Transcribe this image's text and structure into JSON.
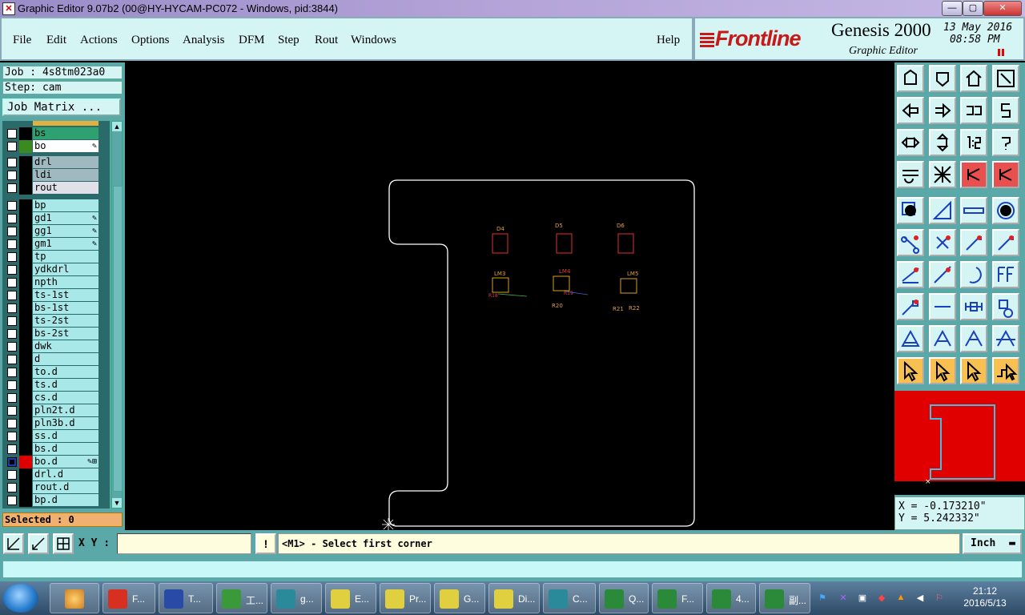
{
  "window": {
    "title": "Graphic Editor 9.07b2 (00@HY-HYCAM-PC072 - Windows, pid:3844)",
    "controls": {
      "minimize": "—",
      "restore": "▢",
      "close": "✕"
    }
  },
  "menu": [
    "File",
    "Edit",
    "Actions",
    "Options",
    "Analysis",
    "DFM",
    "Step",
    "Rout",
    "Windows"
  ],
  "menu_help": "Help",
  "brand": {
    "logo": "Frontline",
    "product": "Genesis 2000",
    "subtitle": "Graphic Editor",
    "date": "13 May 2016",
    "time": "08:58 PM"
  },
  "job": {
    "job_label": "Job : 4s8tm023a0",
    "step_label": "Step: cam",
    "matrix_button": "Job Matrix ..."
  },
  "layers": [
    {
      "name": "bs",
      "color": "#000000",
      "name_bg": "#2fa070",
      "flag": ""
    },
    {
      "name": "bo",
      "color": "#3a8a20",
      "name_bg": "#ffffff",
      "flag": "✎"
    },
    {
      "name": "drl",
      "color": "#000000",
      "name_bg": "#a0b8c0",
      "flag": ""
    },
    {
      "name": "ldi",
      "color": "#000000",
      "name_bg": "#a0b8c0",
      "flag": ""
    },
    {
      "name": "rout",
      "color": "#000000",
      "name_bg": "#e0e0e8",
      "flag": ""
    },
    {
      "name": "bp",
      "color": "#000000",
      "name_bg": "#a8e8e8",
      "flag": ""
    },
    {
      "name": "gd1",
      "color": "#000000",
      "name_bg": "#a8e8e8",
      "flag": "✎"
    },
    {
      "name": "gg1",
      "color": "#000000",
      "name_bg": "#a8e8e8",
      "flag": "✎"
    },
    {
      "name": "gm1",
      "color": "#000000",
      "name_bg": "#a8e8e8",
      "flag": "✎"
    },
    {
      "name": "tp",
      "color": "#000000",
      "name_bg": "#a8e8e8",
      "flag": ""
    },
    {
      "name": "ydkdrl",
      "color": "#000000",
      "name_bg": "#a8e8e8",
      "flag": ""
    },
    {
      "name": "npth",
      "color": "#000000",
      "name_bg": "#a8e8e8",
      "flag": ""
    },
    {
      "name": "ts-1st",
      "color": "#000000",
      "name_bg": "#a8e8e8",
      "flag": ""
    },
    {
      "name": "bs-1st",
      "color": "#000000",
      "name_bg": "#a8e8e8",
      "flag": ""
    },
    {
      "name": "ts-2st",
      "color": "#000000",
      "name_bg": "#a8e8e8",
      "flag": ""
    },
    {
      "name": "bs-2st",
      "color": "#000000",
      "name_bg": "#a8e8e8",
      "flag": ""
    },
    {
      "name": "dwk",
      "color": "#000000",
      "name_bg": "#a8e8e8",
      "flag": ""
    },
    {
      "name": "d",
      "color": "#000000",
      "name_bg": "#a8e8e8",
      "flag": ""
    },
    {
      "name": "to.d",
      "color": "#000000",
      "name_bg": "#a8e8e8",
      "flag": ""
    },
    {
      "name": "ts.d",
      "color": "#000000",
      "name_bg": "#a8e8e8",
      "flag": ""
    },
    {
      "name": "cs.d",
      "color": "#000000",
      "name_bg": "#a8e8e8",
      "flag": ""
    },
    {
      "name": "pln2t.d",
      "color": "#000000",
      "name_bg": "#a8e8e8",
      "flag": ""
    },
    {
      "name": "pln3b.d",
      "color": "#000000",
      "name_bg": "#a8e8e8",
      "flag": ""
    },
    {
      "name": "ss.d",
      "color": "#000000",
      "name_bg": "#a8e8e8",
      "flag": ""
    },
    {
      "name": "bs.d",
      "color": "#000000",
      "name_bg": "#a8e8e8",
      "flag": ""
    },
    {
      "name": "bo.d",
      "color": "#e00000",
      "name_bg": "#a8e8e8",
      "flag": "✎⊞"
    },
    {
      "name": "drl.d",
      "color": "#000000",
      "name_bg": "#a8e8e8",
      "flag": ""
    },
    {
      "name": "rout.d",
      "color": "#000000",
      "name_bg": "#a8e8e8",
      "flag": ""
    },
    {
      "name": "bp.d",
      "color": "#000000",
      "name_bg": "#a8e8e8",
      "flag": ""
    }
  ],
  "selected_label": "Selected : 0",
  "canvas_labels": [
    "D4",
    "D5",
    "D6",
    "LM3",
    "LM4",
    "LM5",
    "R20",
    "R21",
    "R22"
  ],
  "coords": {
    "x": "X = -0.173210\"",
    "y": "Y = 5.242332\""
  },
  "xy_label": "X Y :",
  "xy_value": "",
  "prompt": "<M1> - Select first corner",
  "units": "Inch",
  "colors": {
    "canvas_bg": "#000000",
    "panel": "#5aa8a8",
    "panel_light": "#d5f5f5",
    "outline": "#ffffff",
    "minimap_bg": "#e00000"
  },
  "taskbar": {
    "items": [
      {
        "label": "F...",
        "icon": "#d83020"
      },
      {
        "label": "T...",
        "icon": "#2a4aa8"
      },
      {
        "label": "工...",
        "icon": "#3a9a3a"
      },
      {
        "label": "g...",
        "icon": "#2a8a9a"
      },
      {
        "label": "E...",
        "icon": "#e0d040"
      },
      {
        "label": "Pr...",
        "icon": "#e0d040"
      },
      {
        "label": "G...",
        "icon": "#e0d040"
      },
      {
        "label": "Di...",
        "icon": "#e0d040"
      },
      {
        "label": "C...",
        "icon": "#2a8a9a"
      },
      {
        "label": "Q...",
        "icon": "#2a8a3a"
      },
      {
        "label": "F...",
        "icon": "#2a8a3a"
      },
      {
        "label": "4...",
        "icon": "#2a8a3a"
      },
      {
        "label": "副...",
        "icon": "#2a8a3a"
      }
    ],
    "clock_time": "21:12",
    "clock_date": "2016/5/13"
  }
}
